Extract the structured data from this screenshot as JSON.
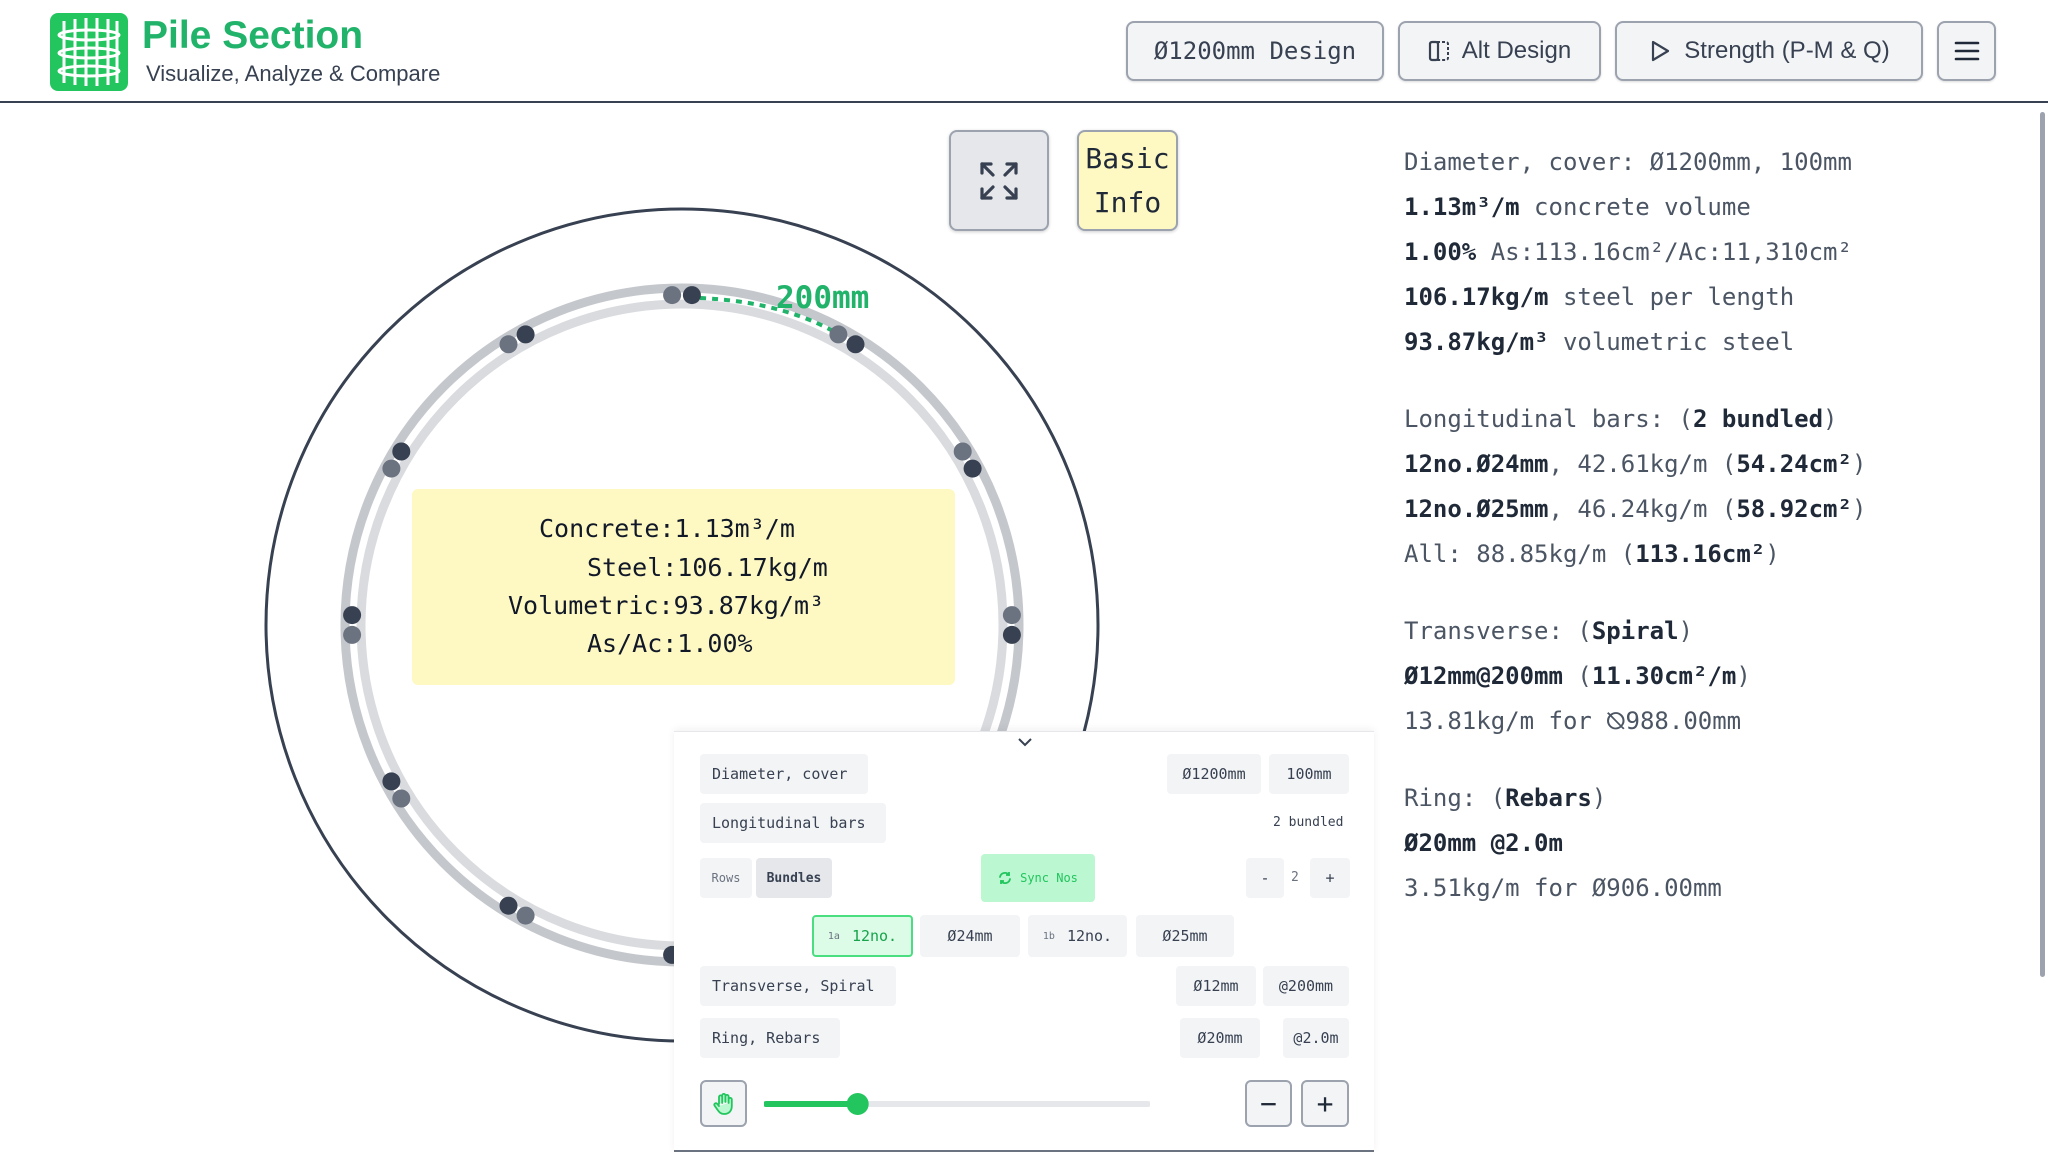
{
  "header": {
    "title": "Pile Section",
    "subtitle": "Visualize, Analyze & Compare",
    "buttons": {
      "design": "Ø1200mm Design",
      "alt": "Alt Design",
      "strength": "Strength (P-M & Q)"
    }
  },
  "canvas": {
    "info_button_line1": "Basic",
    "info_button_line2": "Info",
    "spacing_label": "200mm",
    "summary": {
      "concrete": "Concrete:1.13m³/m",
      "steel": "Steel:106.17kg/m",
      "volumetric": "Volumetric:93.87kg/m³",
      "ratio": "As/Ac:1.00%"
    }
  },
  "info": {
    "diameter_label": "Diameter, cover: ",
    "diameter_value": "Ø1200mm, 100mm",
    "volume_value": "1.13m³/m",
    "volume_label": " concrete volume",
    "ratio_value": "1.00%",
    "ratio_label": " As:113.16cm²/Ac:11,310cm²",
    "steel_value": "106.17kg/m",
    "steel_label": " steel per length",
    "vol_steel_value": "93.87kg/m³",
    "vol_steel_label": " volumetric steel",
    "long_label": "Longitudinal bars: (",
    "long_bundled": "2 bundled",
    "long_close": ")",
    "bar1_name": "12no.Ø24mm",
    "bar1_weight": ", 42.61kg/m (",
    "bar1_area": "54.24cm²",
    "bar1_close": ")",
    "bar2_name": "12no.Ø25mm",
    "bar2_weight": ", 46.24kg/m (",
    "bar2_area": "58.92cm²",
    "bar2_close": ")",
    "all_label": "All: 88.85kg/m (",
    "all_area": "113.16cm²",
    "all_close": ")",
    "trans_label": "Transverse: (",
    "trans_type": "Spiral",
    "trans_close": ")",
    "trans_value": "Ø12mm@200mm",
    "trans_area_open": " (",
    "trans_area": "11.30cm²/m",
    "trans_area_close": ")",
    "trans_weight": "13.81kg/m for ⦰988.00mm",
    "ring_label": "Ring: (",
    "ring_type": "Rebars",
    "ring_close": ")",
    "ring_value": "Ø20mm @2.0m",
    "ring_weight": "3.51kg/m for Ø906.00mm"
  },
  "controls": {
    "diameter_cover_label": "Diameter, cover",
    "diameter_value": "Ø1200mm",
    "cover_value": "100mm",
    "longitudinal_label": "Longitudinal bars",
    "bundled_text": "2 bundled",
    "rows_tab": "Rows",
    "bundles_tab": "Bundles",
    "sync_label": "Sync Nos",
    "minus": "-",
    "count": "2",
    "plus": "+",
    "bar1_tag": "1a",
    "bar1_count": "12no.",
    "bar1_dia": "Ø24mm",
    "bar2_tag": "1b",
    "bar2_count": "12no.",
    "bar2_dia": "Ø25mm",
    "transverse_label": "Transverse, Spiral",
    "transverse_dia": "Ø12mm",
    "transverse_spacing": "@200mm",
    "ring_label": "Ring, Rebars",
    "ring_dia": "Ø20mm",
    "ring_spacing": "@2.0m",
    "slider_value": 0.24,
    "zoom_out": "−",
    "zoom_in": "+"
  },
  "colors": {
    "brand_green": "#22b36b",
    "summary_bg": "#fef9c3",
    "selected_green": "#4ade80"
  }
}
